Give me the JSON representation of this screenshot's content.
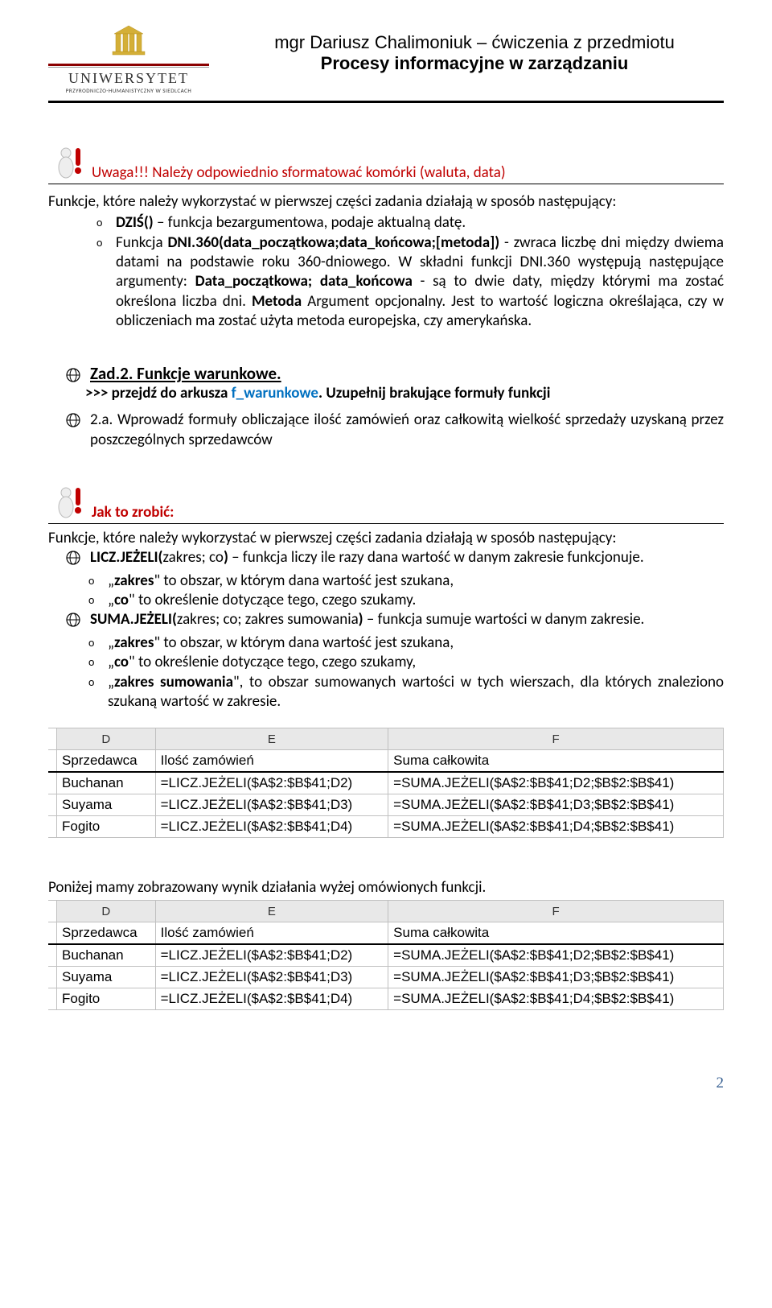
{
  "header": {
    "uni_name": "UNIWERSYTET",
    "uni_sub": "PRZYRODNICZO-HUMANISTYCZNY W SIEDLCACH",
    "line1": "mgr Dariusz Chalimoniuk – ćwiczenia z przedmiotu",
    "line2": "Procesy informacyjne w zarządzaniu"
  },
  "warning": {
    "text": "Uwaga!!! Należy odpowiednio sformatować komórki (waluta, data)"
  },
  "intro": "Funkcje, które należy wykorzystać w pierwszej części zadania działają w sposób następujący:",
  "func1": {
    "name": "DZIŚ()",
    "rest": " – funkcja bezargumentowa, podaje aktualną datę."
  },
  "func2": {
    "pre": "Funkcja ",
    "name": "DNI.360(data_początkowa;data_końcowa;[metoda])",
    "mid1": " - zwraca liczbę dni między dwiema datami na podstawie roku 360-dniowego. W składni funkcji DNI.360 występują następujące argumenty: ",
    "arg1": "Data_początkowa; data_końcowa",
    "mid2": " - są to dwie daty, między którymi ma zostać określona liczba dni. ",
    "arg2": "Metoda",
    "mid3": "   Argument opcjonalny. Jest to wartość logiczna określająca, czy w obliczeniach ma zostać użyta metoda europejska, czy amerykańska."
  },
  "section2": {
    "title": "Zad.2. Funkcje warunkowe.",
    "instr_pre": ">>> przejdź do arkusza ",
    "instr_blue": "f_warunkowe",
    "instr_post": ". Uzupełnij brakujące formuły funkcji",
    "task_a": "2.a. Wprowadź formuły obliczające ilość zamówień oraz całkowitą wielkość sprzedaży uzyskaną przez poszczególnych sprzedawców"
  },
  "howto": {
    "label": "Jak to zrobić:",
    "intro": "Funkcje, które należy wykorzystać w pierwszej części zadania działają w sposób następujący:",
    "fnA_name": "LICZ.JEŻELI(",
    "fnA_args": "zakres; co",
    "fnA_close": ")",
    "fnA_desc": " – funkcja liczy ile razy dana wartość w danym zakresie funkcjonuje.",
    "fnA_s1_b": "zakres",
    "fnA_s1_r": " to obszar, w którym dana wartość jest szukana,",
    "fnA_s2_b": "co",
    "fnA_s2_r": " to określenie dotyczące tego, czego szukamy.",
    "fnB_name": "SUMA.JEŻELI(",
    "fnB_args": "zakres; co; zakres sumowania",
    "fnB_close": ")",
    "fnB_desc": " – funkcja sumuje wartości w danym zakresie.",
    "fnB_s1_b": "zakres",
    "fnB_s1_r": " to obszar, w którym dana wartość jest szukana,",
    "fnB_s2_b": "co",
    "fnB_s2_r": " to określenie dotyczące tego, czego szukamy,",
    "fnB_s3_b": "zakres sumowania",
    "fnB_s3_r": ", to obszar sumowanych wartości w tych wierszach, dla których znaleziono szukaną wartość w zakresie."
  },
  "table": {
    "cols": [
      "D",
      "E",
      "F"
    ],
    "headers": [
      "Sprzedawca",
      "Ilość zamówień",
      "Suma całkowita"
    ],
    "rows": [
      [
        "Buchanan",
        "=LICZ.JEŻELI($A$2:$B$41;D2)",
        "=SUMA.JEŻELI($A$2:$B$41;D2;$B$2:$B$41)"
      ],
      [
        "Suyama",
        "=LICZ.JEŻELI($A$2:$B$41;D3)",
        "=SUMA.JEŻELI($A$2:$B$41;D3;$B$2:$B$41)"
      ],
      [
        "Fogito",
        "=LICZ.JEŻELI($A$2:$B$41;D4)",
        "=SUMA.JEŻELI($A$2:$B$41;D4;$B$2:$B$41)"
      ]
    ]
  },
  "result_note": "Poniżej mamy zobrazowany wynik działania wyżej omówionych funkcji.",
  "page_number": "2"
}
